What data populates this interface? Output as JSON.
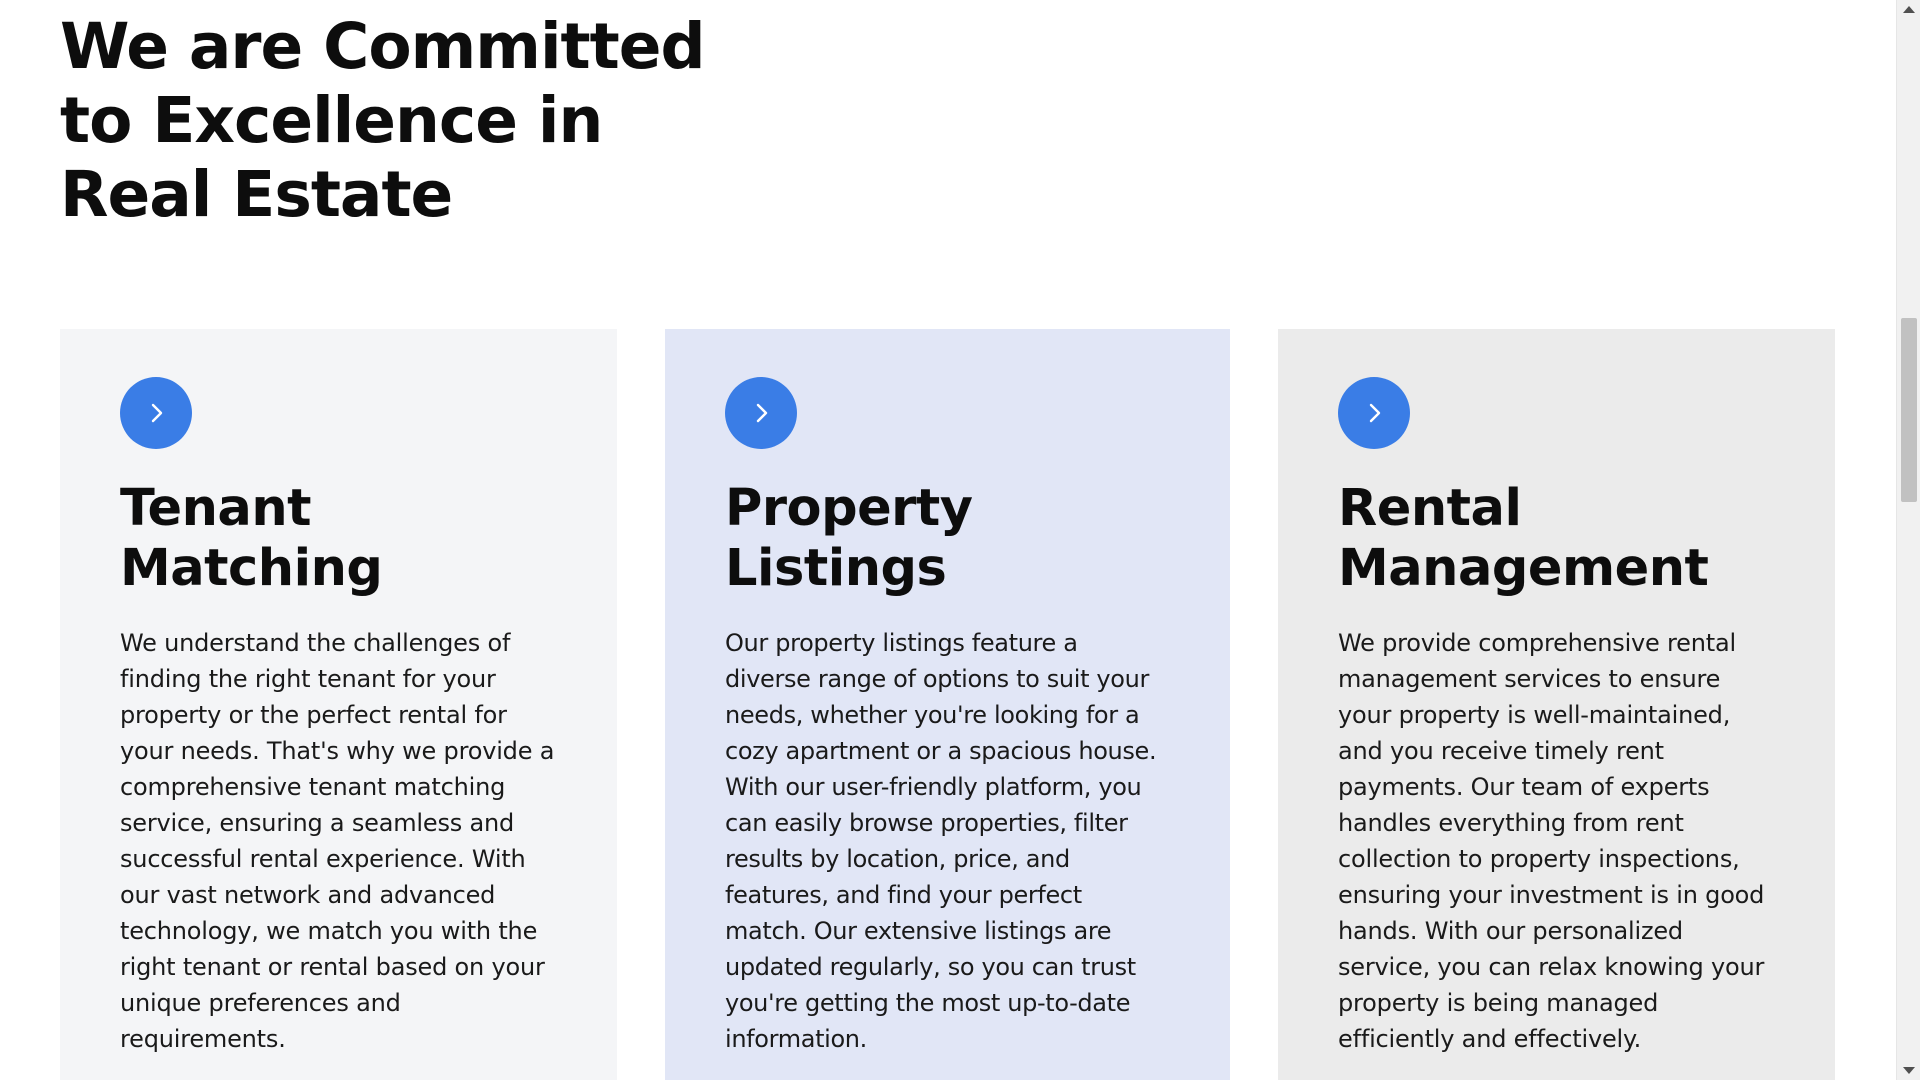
{
  "section": {
    "heading": "We are Committed to Excellence in Real Estate"
  },
  "colors": {
    "accent": "#3a7de6",
    "card_1_bg": "#f4f5f7",
    "card_2_bg": "#e1e6f6",
    "card_3_bg": "#ebebeb"
  },
  "cards": [
    {
      "icon": "chevron-right-icon",
      "title": "Tenant\nMatching",
      "text": "We understand the challenges of finding the right tenant for your property or the perfect rental for your needs. That's why we provide a comprehensive tenant matching service, ensuring a seamless and successful rental experience. With our vast network and advanced technology, we match you with the right tenant or rental based on your unique preferences and requirements."
    },
    {
      "icon": "chevron-right-icon",
      "title": "Property\nListings",
      "text": "Our property listings feature a diverse range of options to suit your needs, whether you're looking for a cozy apartment or a spacious house. With our user-friendly platform, you can easily browse properties, filter results by location, price, and features, and find your perfect match. Our extensive listings are updated regularly, so you can trust you're getting the most up-to-date information."
    },
    {
      "icon": "chevron-right-icon",
      "title": "Rental\nManagement",
      "text": "We provide comprehensive rental management services to ensure your property is well-maintained, and you receive timely rent payments. Our team of experts handles everything from rent collection to property inspections, ensuring your investment is in good hands. With our personalized service, you can relax knowing your property is being managed efficiently and effectively."
    }
  ]
}
